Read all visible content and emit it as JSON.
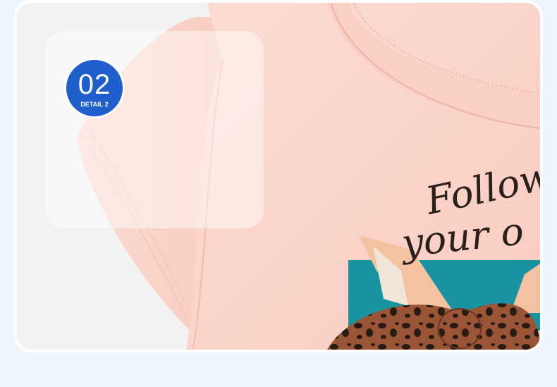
{
  "badge": {
    "number": "02",
    "label": "DETAIL 2"
  },
  "shirt_print": {
    "line1": "Follow",
    "line2": "your o"
  },
  "colors": {
    "page_background": "#eef5fd",
    "badge_blue": "#1e5fcc",
    "shirt_pink": "#fbd3c9",
    "print_teal": "#1a9aa6",
    "bow_brown": "#8a4a2f",
    "ink": "#2b1f1c"
  }
}
